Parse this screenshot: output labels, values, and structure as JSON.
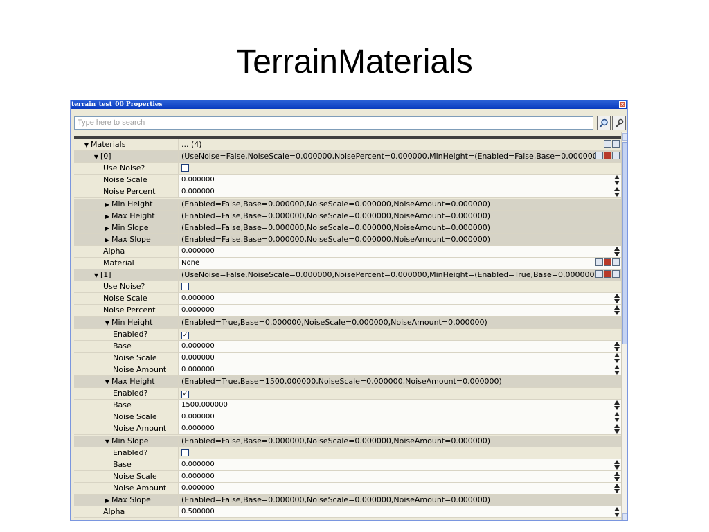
{
  "slide": {
    "title": "TerrainMaterials"
  },
  "window": {
    "title": "terrain_test_00 Properties",
    "close": "×"
  },
  "search": {
    "placeholder": "Type here to search"
  },
  "colors": {
    "titlebar": "#0a3bbf",
    "panel": "#ece9d8",
    "group_row": "#d6d3c6",
    "scroll_thumb": "#c5d3f2"
  },
  "rows": [
    {
      "name": "Materials",
      "value": "... (4)",
      "indent": 1,
      "caret": "down",
      "group": false,
      "kind": "text",
      "control": "icons2"
    },
    {
      "name": "[0]",
      "value": "(UseNoise=False,NoiseScale=0.000000,NoisePercent=0.000000,MinHeight=(Enabled=False,Base=0.000000",
      "indent": 2,
      "caret": "down",
      "group": true,
      "kind": "text",
      "control": "icons3"
    },
    {
      "name": "Use Noise?",
      "value": "",
      "indent": 3,
      "group": false,
      "kind": "checkbox",
      "checked": false
    },
    {
      "name": "Noise Scale",
      "value": "0.000000",
      "indent": 3,
      "group": false,
      "kind": "plain",
      "control": "spinner"
    },
    {
      "name": "Noise Percent",
      "value": "0.000000",
      "indent": 3,
      "group": false,
      "kind": "plain",
      "control": "spinner"
    },
    {
      "name": "Min Height",
      "value": "(Enabled=False,Base=0.000000,NoiseScale=0.000000,NoiseAmount=0.000000)",
      "indent": 3,
      "caret": "right",
      "group": true,
      "kind": "text"
    },
    {
      "name": "Max Height",
      "value": "(Enabled=False,Base=0.000000,NoiseScale=0.000000,NoiseAmount=0.000000)",
      "indent": 3,
      "caret": "right",
      "group": true,
      "kind": "text"
    },
    {
      "name": "Min Slope",
      "value": "(Enabled=False,Base=0.000000,NoiseScale=0.000000,NoiseAmount=0.000000)",
      "indent": 3,
      "caret": "right",
      "group": true,
      "kind": "text"
    },
    {
      "name": "Max Slope",
      "value": "(Enabled=False,Base=0.000000,NoiseScale=0.000000,NoiseAmount=0.000000)",
      "indent": 3,
      "caret": "right",
      "group": true,
      "kind": "text"
    },
    {
      "name": "Alpha",
      "value": "0.000000",
      "indent": 3,
      "group": false,
      "kind": "plain",
      "control": "spinner"
    },
    {
      "name": "Material",
      "value": "None",
      "indent": 3,
      "group": false,
      "kind": "plain",
      "control": "icons3"
    },
    {
      "name": "[1]",
      "value": "(UseNoise=False,NoiseScale=0.000000,NoisePercent=0.000000,MinHeight=(Enabled=True,Base=0.000000,",
      "indent": 2,
      "caret": "down",
      "group": true,
      "kind": "text",
      "control": "icons3"
    },
    {
      "name": "Use Noise?",
      "value": "",
      "indent": 3,
      "group": false,
      "kind": "checkbox",
      "checked": false
    },
    {
      "name": "Noise Scale",
      "value": "0.000000",
      "indent": 3,
      "group": false,
      "kind": "plain",
      "control": "spinner"
    },
    {
      "name": "Noise Percent",
      "value": "0.000000",
      "indent": 3,
      "group": false,
      "kind": "plain",
      "control": "spinner"
    },
    {
      "name": "Min Height",
      "value": "(Enabled=True,Base=0.000000,NoiseScale=0.000000,NoiseAmount=0.000000)",
      "indent": 3,
      "caret": "down",
      "group": true,
      "kind": "text"
    },
    {
      "name": "Enabled?",
      "value": "",
      "indent": 4,
      "group": false,
      "kind": "checkbox",
      "checked": true
    },
    {
      "name": "Base",
      "value": "0.000000",
      "indent": 4,
      "group": false,
      "kind": "plain",
      "control": "spinner"
    },
    {
      "name": "Noise Scale",
      "value": "0.000000",
      "indent": 4,
      "group": false,
      "kind": "plain",
      "control": "spinner"
    },
    {
      "name": "Noise Amount",
      "value": "0.000000",
      "indent": 4,
      "group": false,
      "kind": "plain",
      "control": "spinner"
    },
    {
      "name": "Max Height",
      "value": "(Enabled=True,Base=1500.000000,NoiseScale=0.000000,NoiseAmount=0.000000)",
      "indent": 3,
      "caret": "down",
      "group": true,
      "kind": "text"
    },
    {
      "name": "Enabled?",
      "value": "",
      "indent": 4,
      "group": false,
      "kind": "checkbox",
      "checked": true
    },
    {
      "name": "Base",
      "value": "1500.000000",
      "indent": 4,
      "group": false,
      "kind": "plain",
      "control": "spinner"
    },
    {
      "name": "Noise Scale",
      "value": "0.000000",
      "indent": 4,
      "group": false,
      "kind": "plain",
      "control": "spinner"
    },
    {
      "name": "Noise Amount",
      "value": "0.000000",
      "indent": 4,
      "group": false,
      "kind": "plain",
      "control": "spinner"
    },
    {
      "name": "Min Slope",
      "value": "(Enabled=False,Base=0.000000,NoiseScale=0.000000,NoiseAmount=0.000000)",
      "indent": 3,
      "caret": "down",
      "group": true,
      "kind": "text"
    },
    {
      "name": "Enabled?",
      "value": "",
      "indent": 4,
      "group": false,
      "kind": "checkbox",
      "checked": false
    },
    {
      "name": "Base",
      "value": "0.000000",
      "indent": 4,
      "group": false,
      "kind": "plain",
      "control": "spinner"
    },
    {
      "name": "Noise Scale",
      "value": "0.000000",
      "indent": 4,
      "group": false,
      "kind": "plain",
      "control": "spinner"
    },
    {
      "name": "Noise Amount",
      "value": "0.000000",
      "indent": 4,
      "group": false,
      "kind": "plain",
      "control": "spinner"
    },
    {
      "name": "Max Slope",
      "value": "(Enabled=False,Base=0.000000,NoiseScale=0.000000,NoiseAmount=0.000000)",
      "indent": 3,
      "caret": "right",
      "group": true,
      "kind": "text"
    },
    {
      "name": "Alpha",
      "value": "0.500000",
      "indent": 3,
      "group": false,
      "kind": "plain",
      "control": "spinner"
    }
  ]
}
